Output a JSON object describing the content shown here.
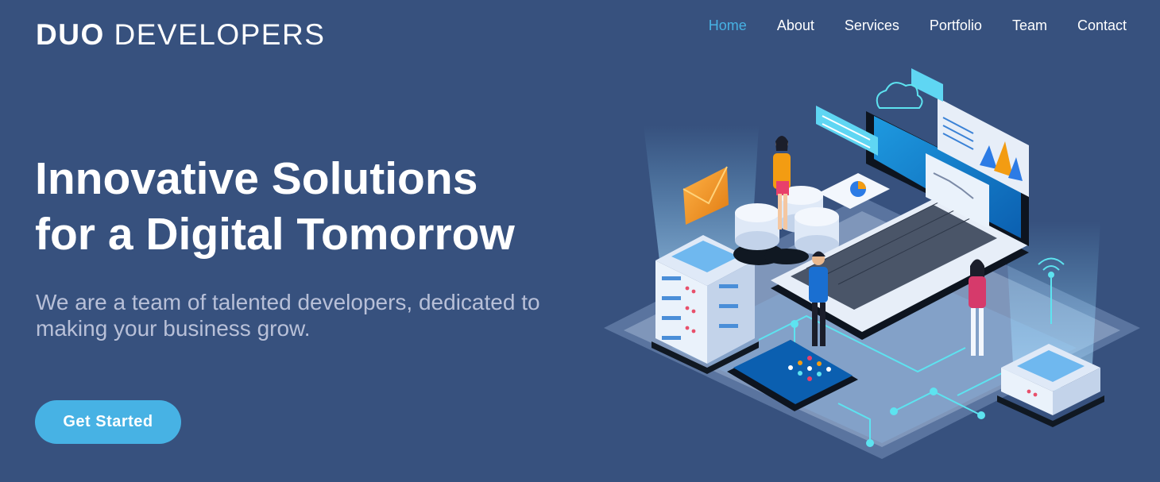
{
  "logo": {
    "bold": "DUO",
    "light": "DEVELOPERS"
  },
  "nav": [
    {
      "label": "Home",
      "active": true
    },
    {
      "label": "About"
    },
    {
      "label": "Services"
    },
    {
      "label": "Portfolio"
    },
    {
      "label": "Team"
    },
    {
      "label": "Contact"
    }
  ],
  "hero": {
    "title_line1": "Innovative Solutions",
    "title_line2": "for a Digital Tomorrow",
    "subtitle": "We are a team of talented developers, dedicated to making your business grow.",
    "cta": "Get Started"
  },
  "colors": {
    "background": "#37517e",
    "accent": "#47b2e4",
    "subtitle": "#b8c0d8"
  },
  "illustration": "isometric-developer-workspace"
}
